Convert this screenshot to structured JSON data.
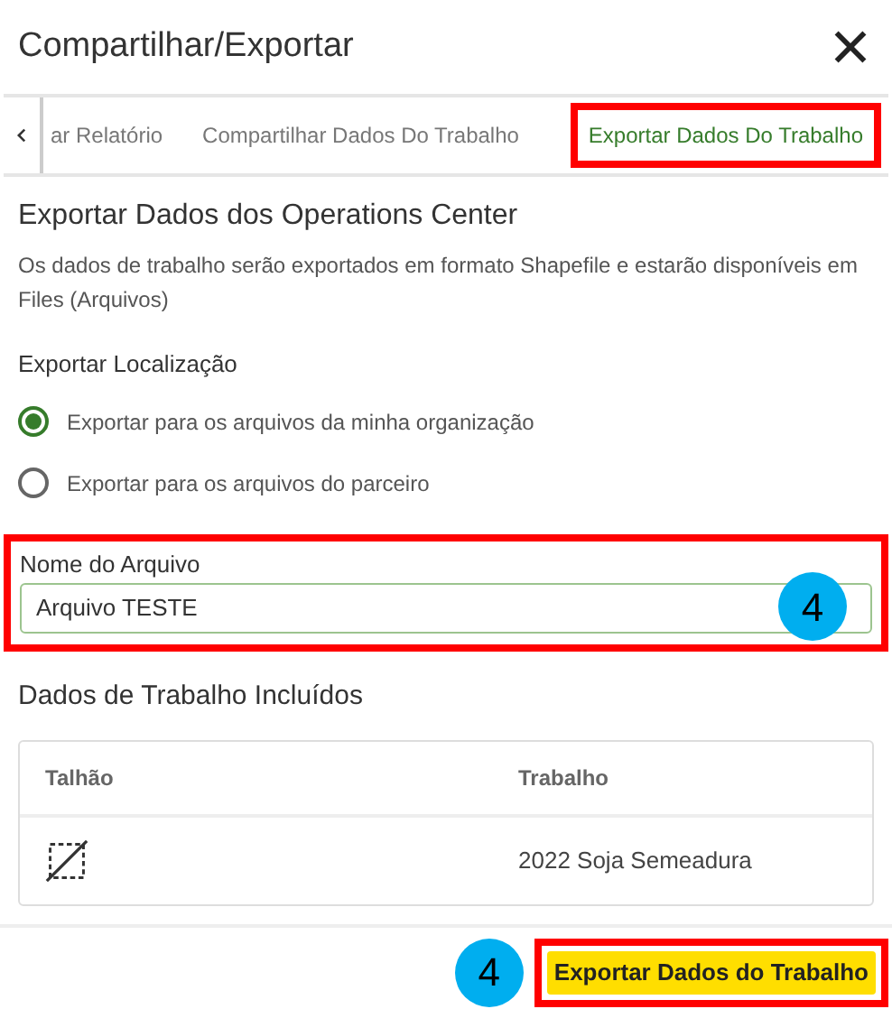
{
  "dialog": {
    "title": "Compartilhar/Exportar"
  },
  "tabs": [
    {
      "label": "ar Relatório",
      "selected": false,
      "highlighted": false
    },
    {
      "label": "Compartilhar Dados Do Trabalho",
      "selected": false,
      "highlighted": false
    },
    {
      "label": "Exportar Dados Do Trabalho",
      "selected": true,
      "highlighted": true
    }
  ],
  "section": {
    "heading": "Exportar Dados dos Operations Center",
    "description": "Os dados de trabalho serão exportados em formato Shapefile e estarão disponíveis em Files (Arquivos)"
  },
  "export_location": {
    "label": "Exportar Localização",
    "options": [
      {
        "label": "Exportar para os arquivos da minha organização",
        "selected": true
      },
      {
        "label": "Exportar para os arquivos do parceiro",
        "selected": false
      }
    ]
  },
  "file_name": {
    "label": "Nome do Arquivo",
    "value": "Arquivo TESTE",
    "highlighted": true,
    "badge": "4"
  },
  "included": {
    "heading": "Dados de Trabalho Incluídos",
    "columns": [
      "Talhão",
      "Trabalho"
    ],
    "rows": [
      {
        "job": "2022 Soja Semeadura"
      }
    ]
  },
  "footer": {
    "button": "Exportar Dados do Trabalho",
    "highlighted": true,
    "badge": "4"
  }
}
